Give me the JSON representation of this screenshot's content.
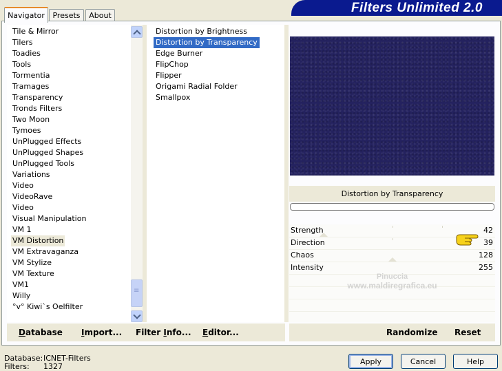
{
  "tabs": [
    "Navigator",
    "Presets",
    "About"
  ],
  "banner_title": "Filters Unlimited 2.0",
  "categories": [
    "Tile & Mirror",
    "Tilers",
    "Toadies",
    "Tools",
    "Tormentia",
    "Tramages",
    "Transparency",
    "Tronds Filters",
    "Two Moon",
    "Tymoes",
    "UnPlugged Effects",
    "UnPlugged Shapes",
    "UnPlugged Tools",
    "Variations",
    "Video",
    "VideoRave",
    "Video",
    "Visual Manipulation",
    "VM 1",
    "VM Distortion",
    "VM Extravaganza",
    "VM Stylize",
    "VM Texture",
    "VM1",
    "Willy",
    "°v° Kiwi`s Oelfilter"
  ],
  "selected_category": "VM Distortion",
  "filters": [
    "Distortion by Brightness",
    "Distortion by Transparency",
    "Edge Burner",
    "FlipChop",
    "Flipper",
    "Origami Radial Folder",
    "Smallpox"
  ],
  "selected_filter": "Distortion by Transparency",
  "filter_title": "Distortion by Transparency",
  "params": [
    {
      "name": "Strength",
      "value": "42"
    },
    {
      "name": "Direction",
      "value": "39"
    },
    {
      "name": "Chaos",
      "value": "128"
    },
    {
      "name": "Intensity",
      "value": "255"
    }
  ],
  "watermark": {
    "line1": "Pinuccia",
    "line2": "www.maldiregrafica.eu"
  },
  "left_buttons": {
    "database": "Database",
    "import": "Import...",
    "filter_info": "Filter Info...",
    "editor": "Editor..."
  },
  "right_buttons": {
    "randomize": "Randomize",
    "reset": "Reset"
  },
  "footer": {
    "database_label": "Database:",
    "database_value": "ICNET-Filters",
    "filters_label": "Filters:",
    "filters_value": "1327"
  },
  "dialog_buttons": {
    "apply": "Apply",
    "cancel": "Cancel",
    "help": "Help"
  },
  "colors": {
    "banner": "#0a1a8f",
    "selection": "#316ac5",
    "preview": "#24225f"
  }
}
